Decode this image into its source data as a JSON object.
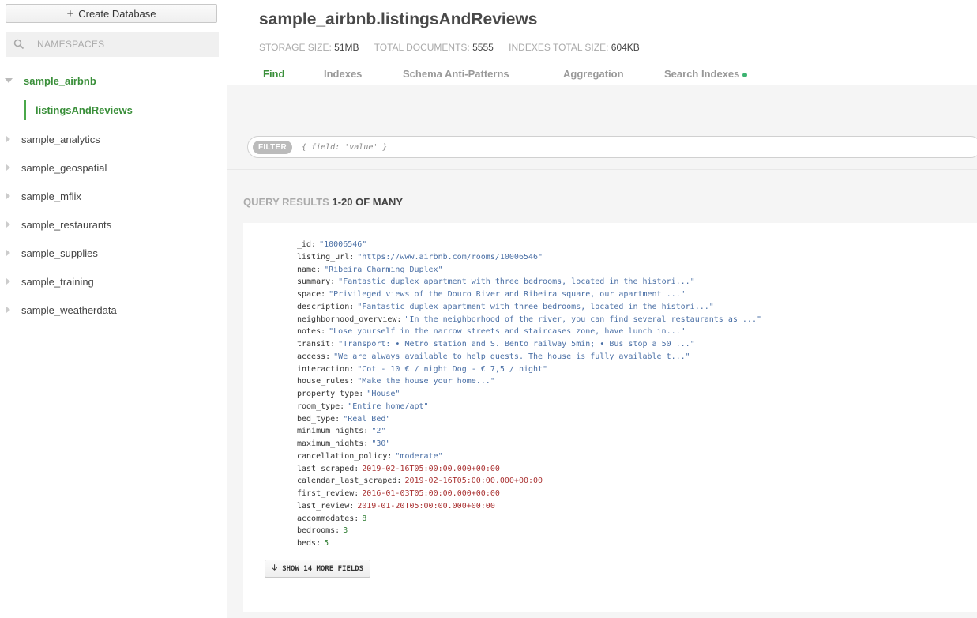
{
  "sidebar": {
    "create_label": "Create Database",
    "search_placeholder": "NAMESPACES",
    "databases": [
      {
        "name": "sample_airbnb",
        "expanded": true,
        "collections": [
          "listingsAndReviews"
        ]
      },
      {
        "name": "sample_analytics"
      },
      {
        "name": "sample_geospatial"
      },
      {
        "name": "sample_mflix"
      },
      {
        "name": "sample_restaurants"
      },
      {
        "name": "sample_supplies"
      },
      {
        "name": "sample_training"
      },
      {
        "name": "sample_weatherdata"
      }
    ]
  },
  "header": {
    "title": "sample_airbnb.listingsAndReviews",
    "stats": [
      {
        "label": "STORAGE SIZE:",
        "value": "51MB"
      },
      {
        "label": "TOTAL DOCUMENTS:",
        "value": "5555"
      },
      {
        "label": "INDEXES TOTAL SIZE:",
        "value": "604KB"
      }
    ]
  },
  "tabs": [
    "Find",
    "Indexes",
    "Schema Anti-Patterns",
    "Aggregation",
    "Search Indexes"
  ],
  "active_tab": "Find",
  "filter": {
    "label": "FILTER",
    "placeholder": "{ field: 'value' }"
  },
  "results": {
    "label": "QUERY RESULTS",
    "range": "1-20 OF MANY"
  },
  "document": {
    "fields": [
      {
        "key": "_id:",
        "value": "\"10006546\"",
        "type": "str"
      },
      {
        "key": "listing_url:",
        "value": "\"https://www.airbnb.com/rooms/10006546\"",
        "type": "str"
      },
      {
        "key": "name:",
        "value": "\"Ribeira Charming Duplex\"",
        "type": "str"
      },
      {
        "key": "summary:",
        "value": "\"Fantastic duplex apartment with three bedrooms, located in the histori...\"",
        "type": "str"
      },
      {
        "key": "space:",
        "value": "\"Privileged views of the Douro River and Ribeira square, our apartment ...\"",
        "type": "str"
      },
      {
        "key": "description:",
        "value": "\"Fantastic duplex apartment with three bedrooms, located in the histori...\"",
        "type": "str"
      },
      {
        "key": "neighborhood_overview:",
        "value": "\"In the neighborhood of the river, you can find several restaurants as ...\"",
        "type": "str"
      },
      {
        "key": "notes:",
        "value": "\"Lose yourself in the narrow streets and staircases zone, have lunch in...\"",
        "type": "str"
      },
      {
        "key": "transit:",
        "value": "\"Transport: • Metro station and S. Bento railway 5min; • Bus stop a 50 ...\"",
        "type": "str"
      },
      {
        "key": "access:",
        "value": "\"We are always available to help guests. The house is fully available t...\"",
        "type": "str"
      },
      {
        "key": "interaction:",
        "value": "\"Cot - 10 € / night Dog - € 7,5 / night\"",
        "type": "str"
      },
      {
        "key": "house_rules:",
        "value": "\"Make the house your home...\"",
        "type": "str"
      },
      {
        "key": "property_type:",
        "value": "\"House\"",
        "type": "str"
      },
      {
        "key": "room_type:",
        "value": "\"Entire home/apt\"",
        "type": "str"
      },
      {
        "key": "bed_type:",
        "value": "\"Real Bed\"",
        "type": "str"
      },
      {
        "key": "minimum_nights:",
        "value": "\"2\"",
        "type": "str"
      },
      {
        "key": "maximum_nights:",
        "value": "\"30\"",
        "type": "str"
      },
      {
        "key": "cancellation_policy:",
        "value": "\"moderate\"",
        "type": "str"
      },
      {
        "key": "last_scraped:",
        "value": "2019-02-16T05:00:00.000+00:00",
        "type": "date"
      },
      {
        "key": "calendar_last_scraped:",
        "value": "2019-02-16T05:00:00.000+00:00",
        "type": "date"
      },
      {
        "key": "first_review:",
        "value": "2016-01-03T05:00:00.000+00:00",
        "type": "date"
      },
      {
        "key": "last_review:",
        "value": "2019-01-20T05:00:00.000+00:00",
        "type": "date"
      },
      {
        "key": "accommodates:",
        "value": "8",
        "type": "num"
      },
      {
        "key": "bedrooms:",
        "value": "3",
        "type": "num"
      },
      {
        "key": "beds:",
        "value": "5",
        "type": "num"
      }
    ],
    "show_more_label": "SHOW 14 MORE FIELDS"
  }
}
